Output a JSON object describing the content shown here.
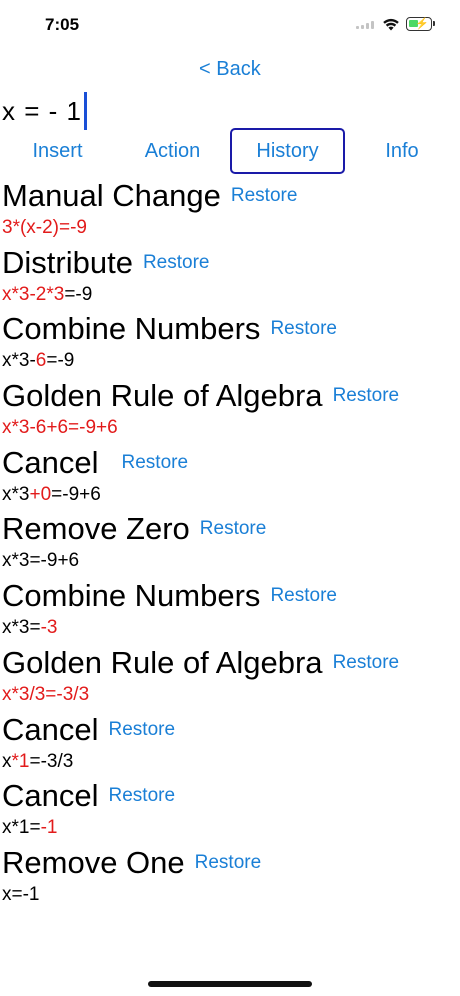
{
  "status_bar": {
    "time": "7:05"
  },
  "nav": {
    "back_label": "< Back"
  },
  "equation": {
    "value": "x = - 1"
  },
  "tabs": [
    {
      "label": "Insert",
      "selected": false
    },
    {
      "label": "Action",
      "selected": false
    },
    {
      "label": "History",
      "selected": true
    },
    {
      "label": "Info",
      "selected": false
    }
  ],
  "restore_label": "Restore",
  "history": [
    {
      "title": "Manual Change",
      "expression": [
        {
          "text": "3*(x-2)=-9",
          "red": true
        }
      ]
    },
    {
      "title": "Distribute",
      "expression": [
        {
          "text": "x*3-2*3",
          "red": true
        },
        {
          "text": "=-9",
          "red": false
        }
      ]
    },
    {
      "title": "Combine Numbers",
      "expression": [
        {
          "text": "x*3-",
          "red": false
        },
        {
          "text": "6",
          "red": true
        },
        {
          "text": "=-9",
          "red": false
        }
      ]
    },
    {
      "title": "Golden Rule of Algebra",
      "expression": [
        {
          "text": "x*3-6+6=-9+6",
          "red": true
        }
      ]
    },
    {
      "title": "Cancel",
      "expression": [
        {
          "text": "x*3",
          "red": false
        },
        {
          "text": "+0",
          "red": true
        },
        {
          "text": "=-9+6",
          "red": false
        }
      ]
    },
    {
      "title": "Remove Zero",
      "expression": [
        {
          "text": "x*3=-9+6",
          "red": false
        }
      ]
    },
    {
      "title": "Combine Numbers",
      "expression": [
        {
          "text": "x*3=",
          "red": false
        },
        {
          "text": "-3",
          "red": true
        }
      ]
    },
    {
      "title": "Golden Rule of Algebra",
      "expression": [
        {
          "text": "x*3/3=-3/3",
          "red": true
        }
      ]
    },
    {
      "title": "Cancel",
      "expression": [
        {
          "text": "x",
          "red": false
        },
        {
          "text": "*1",
          "red": true
        },
        {
          "text": "=-3/3",
          "red": false
        }
      ]
    },
    {
      "title": "Cancel",
      "expression": [
        {
          "text": "x*1=",
          "red": false
        },
        {
          "text": "-1",
          "red": true
        }
      ]
    },
    {
      "title": "Remove One",
      "expression": [
        {
          "text": "x=-1",
          "red": false
        }
      ]
    }
  ],
  "colors": {
    "link": "#1a7fd6",
    "highlight": "#e21b1b",
    "tab_border": "#1a1aa8",
    "caret": "#1a4fd6"
  },
  "icons": {
    "signal": "cellular-signal-icon",
    "wifi": "wifi-icon",
    "battery": "battery-charging-icon"
  }
}
